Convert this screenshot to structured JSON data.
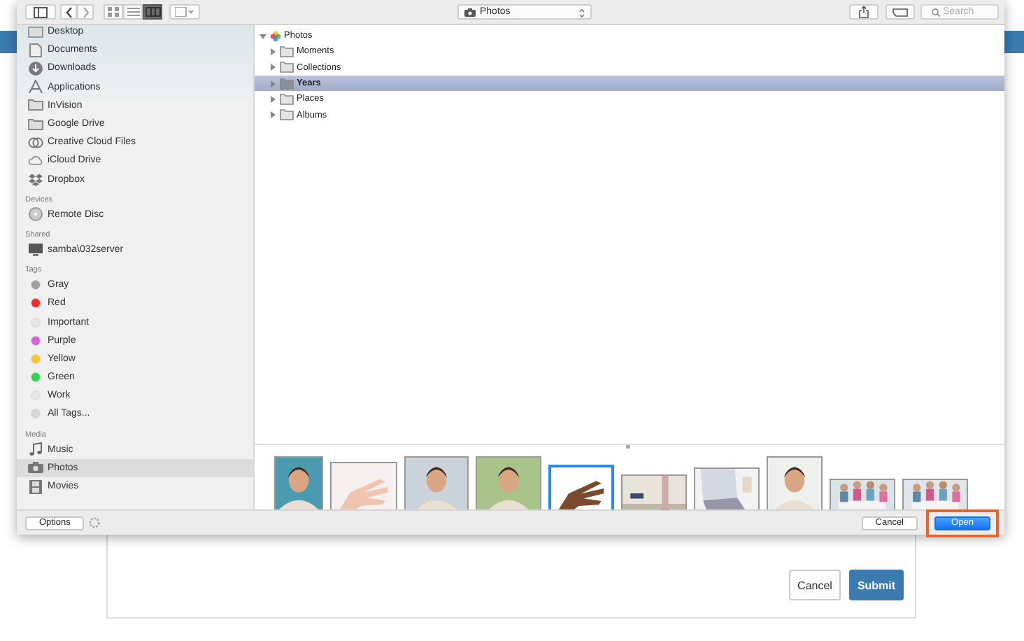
{
  "toolbar": {
    "location": "Photos",
    "search": {
      "placeholder": "Search"
    },
    "views": [
      {
        "kind": "icons",
        "selected": false
      },
      {
        "kind": "list",
        "selected": false
      },
      {
        "kind": "columns",
        "selected": true
      }
    ]
  },
  "sidebar": {
    "sections": [
      {
        "items": [
          {
            "label": "Desktop",
            "kind": "desktop",
            "selected": false
          },
          {
            "label": "Documents",
            "kind": "document",
            "selected": false
          },
          {
            "label": "Downloads",
            "kind": "download",
            "selected": false
          },
          {
            "label": "Applications",
            "kind": "apps",
            "selected": false
          },
          {
            "label": "InVision",
            "kind": "folder",
            "selected": false
          },
          {
            "label": "Google Drive",
            "kind": "folder",
            "selected": false
          },
          {
            "label": "Creative Cloud Files",
            "kind": "cloudfiles",
            "selected": false
          },
          {
            "label": "iCloud Drive",
            "kind": "cloud",
            "selected": false
          },
          {
            "label": "Dropbox",
            "kind": "dropbox",
            "selected": false
          }
        ]
      },
      {
        "header": "Devices",
        "items": [
          {
            "label": "Remote Disc",
            "kind": "disc",
            "selected": false
          }
        ]
      },
      {
        "header": "Shared",
        "items": [
          {
            "label": "samba\\032server",
            "kind": "monitor",
            "selected": false
          }
        ]
      },
      {
        "header": "Tags",
        "items": [
          {
            "label": "Gray",
            "kind": "tag",
            "color": "#a0a0a0",
            "selected": false
          },
          {
            "label": "Red",
            "kind": "tag",
            "color": "#fc2a2a",
            "selected": false
          },
          {
            "label": "Important",
            "kind": "tag",
            "color": "#e6e6e6",
            "selected": false
          },
          {
            "label": "Purple",
            "kind": "tag",
            "color": "#dd5fe0",
            "selected": false
          },
          {
            "label": "Yellow",
            "kind": "tag",
            "color": "#fdc62f",
            "selected": false
          },
          {
            "label": "Green",
            "kind": "tag",
            "color": "#2fd54a",
            "selected": false
          },
          {
            "label": "Work",
            "kind": "tag",
            "color": "#e6e6e6",
            "selected": false
          },
          {
            "label": "All Tags...",
            "kind": "tag",
            "color": "#d6d6d6",
            "selected": false
          }
        ]
      },
      {
        "header": "Media",
        "items": [
          {
            "label": "Music",
            "kind": "music",
            "selected": false
          },
          {
            "label": "Photos",
            "kind": "camera",
            "selected": true
          },
          {
            "label": "Movies",
            "kind": "film",
            "selected": false
          }
        ]
      }
    ]
  },
  "tree": {
    "label": "Photos",
    "expanded": true,
    "children": [
      {
        "label": "Moments",
        "expanded": false,
        "selected": false
      },
      {
        "label": "Collections",
        "expanded": false,
        "selected": false
      },
      {
        "label": "Years",
        "expanded": false,
        "selected": true
      },
      {
        "label": "Places",
        "expanded": false,
        "selected": false
      },
      {
        "label": "Albums",
        "expanded": false,
        "selected": false
      }
    ]
  },
  "thumbnails": [
    {
      "selected": false
    },
    {
      "selected": false
    },
    {
      "selected": false
    },
    {
      "selected": false
    },
    {
      "selected": true
    },
    {
      "selected": false
    },
    {
      "selected": false
    },
    {
      "selected": false
    },
    {
      "selected": false
    },
    {
      "selected": false
    }
  ],
  "footer": {
    "options": "Options",
    "cancel": "Cancel",
    "open": "Open",
    "open_highlighted": true
  },
  "form": {
    "cancel": "Cancel",
    "submit": "Submit"
  }
}
